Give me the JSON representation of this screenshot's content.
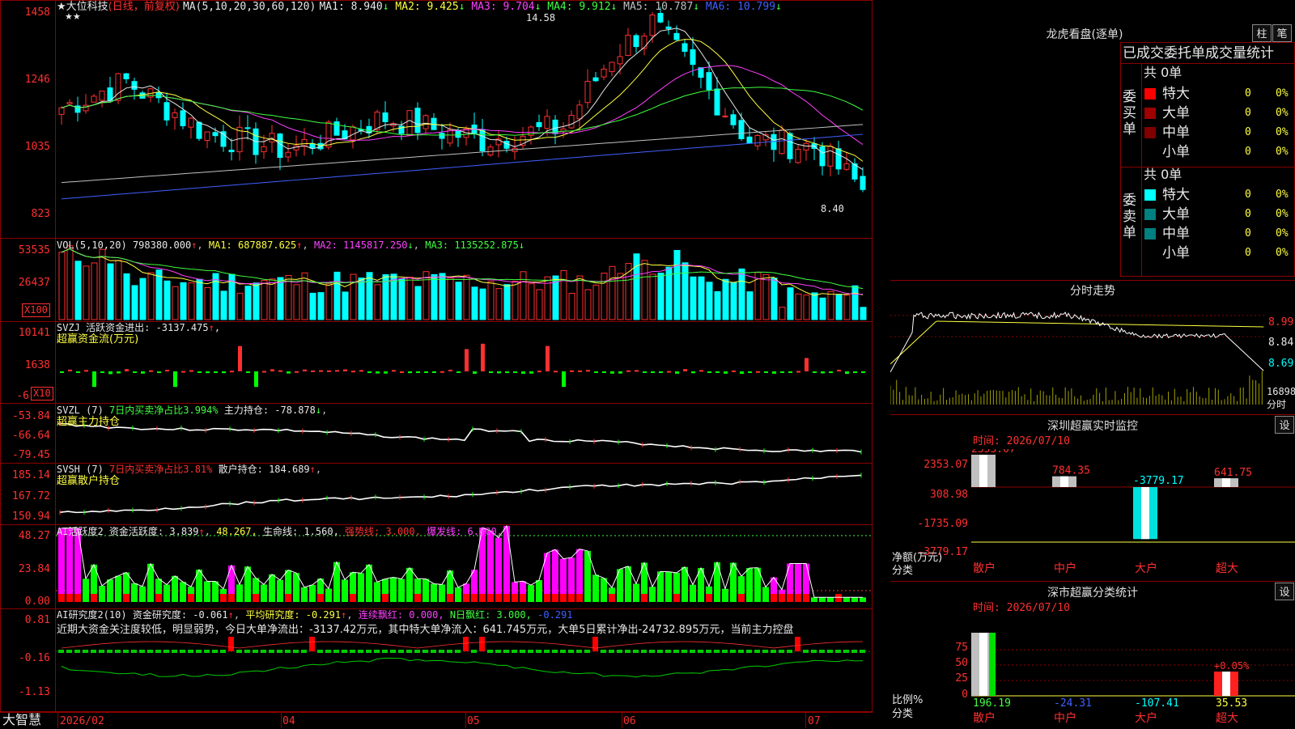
{
  "main": {
    "stock": "大位科技",
    "period": "(日线，前复权)",
    "ma_title": "MA(5,10,20,30,60,120)",
    "ma_vals": [
      {
        "label": "MA1:",
        "value": "8.940",
        "color": "#e8e8e8",
        "arrow": "↓"
      },
      {
        "label": "MA2:",
        "value": "9.425",
        "color": "#ffff40",
        "arrow": "↓"
      },
      {
        "label": "MA3:",
        "value": "9.704",
        "color": "#ff40ff",
        "arrow": "↓"
      },
      {
        "label": "MA4:",
        "value": "9.912",
        "color": "#40ff40",
        "arrow": "↓"
      },
      {
        "label": "MA5:",
        "value": "10.787",
        "color": "#c0c0c0",
        "arrow": "↓"
      },
      {
        "label": "MA6:",
        "value": "10.799",
        "color": "#4060ff",
        "arrow": "↓"
      }
    ],
    "yticks": [
      "1458",
      "1246",
      "1035",
      "823"
    ],
    "high_label": "14.58",
    "low_label": "8.40"
  },
  "vol": {
    "title": "VOL(5,10,20)",
    "value": "798380.000",
    "ma1": "MA1: 687887.625",
    "ma2": "MA2: 1145817.250",
    "ma3": "MA3: 1135252.875",
    "yticks": [
      "53535",
      "26437"
    ],
    "unit": "X100"
  },
  "svzj": {
    "title": "SVZJ  活跃资金进出: -3137.475",
    "subtitle": "超赢资金流(万元)",
    "yticks": [
      "10141",
      "1638",
      "-6"
    ],
    "unit": "X10"
  },
  "svzl": {
    "title": "SVZL (7)",
    "ratio": "7日内买卖净占比3.994%",
    "hold": "主力持仓: -78.878",
    "subtitle": "超赢主力持仓",
    "yticks": [
      "-53.84",
      "-66.64",
      "-79.45"
    ]
  },
  "svsh": {
    "title": "SVSH (7)",
    "ratio": "7日内买卖净占比3.81%",
    "hold": "散户持仓: 184.689",
    "subtitle": "超赢散户持仓",
    "yticks": [
      "185.14",
      "167.72",
      "150.94"
    ]
  },
  "ai1": {
    "title": "AI活跃度2",
    "v1": "资金活跃度: 3.839",
    "v2": "48.267,",
    "v3": "生命线: 1.560,",
    "v4": "强势线: 3.000,",
    "v5": "爆发线: 6.000,",
    "yticks": [
      "48.27",
      "23.84",
      "0.00"
    ]
  },
  "ai2": {
    "title": "AI研究度2(10)",
    "v1": "资金研究度: -0.061",
    "v2": "平均研究度: -0.291",
    "v3": "连续飘红: 0.000,",
    "v4": "N日飘红: 3.000,",
    "v5": "-0.291",
    "comment": "近期大资金关注度较低，明显弱势，今日大单净流出：-3137.42万元，其中特大单净流入：641.745万元，大单5日累计净出-24732.895万元，当前主力控盘",
    "yticks": [
      "0.81",
      "-0.16",
      "-1.13"
    ]
  },
  "xaxis": {
    "brand": "大智慧",
    "labels": [
      "2026/02",
      "04",
      "05",
      "06",
      "07"
    ]
  },
  "dragon": {
    "title": "龙虎看盘(逐单)",
    "btn1": "柱",
    "btn2": "笔",
    "header": "已成交委托单成交量统计",
    "buy_label": "委买单",
    "sell_label": "委卖单",
    "buy_total": "共 0单",
    "sell_total": "共 0单",
    "buy_rows": [
      {
        "name": "特大",
        "color": "#ff0000",
        "count": "0",
        "pct": "0%"
      },
      {
        "name": "大单",
        "color": "#a00000",
        "count": "0",
        "pct": "0%"
      },
      {
        "name": "中单",
        "color": "#800000",
        "count": "0",
        "pct": "0%"
      },
      {
        "name": "小单",
        "color": "#000000",
        "count": "0",
        "pct": "0%"
      }
    ],
    "sell_rows": [
      {
        "name": "特大",
        "color": "#00ffff",
        "count": "0",
        "pct": "0%"
      },
      {
        "name": "大单",
        "color": "#008080",
        "count": "0",
        "pct": "0%"
      },
      {
        "name": "中单",
        "color": "#008080",
        "count": "0",
        "pct": "0%"
      },
      {
        "name": "小单",
        "color": "#000000",
        "count": "0",
        "pct": "0%"
      }
    ]
  },
  "intraday": {
    "title": "分时走势",
    "yticks": [
      "8.99",
      "8.84",
      "8.69"
    ],
    "vol_label": "16898",
    "unit": "分时"
  },
  "monitor": {
    "title": "深圳超赢实时监控",
    "btn": "设",
    "time": "时间: 2026/07/10",
    "yticks": [
      "2353.07",
      "308.98",
      "-1735.09",
      "-3779.17"
    ],
    "unit1": "净额(万元)",
    "unit2": "分类",
    "cats": [
      "散户",
      "中户",
      "大户",
      "超大"
    ],
    "bar_labels": [
      "2353.07",
      "784.35",
      "-3779.17",
      "641.75"
    ]
  },
  "classify": {
    "title": "深市超赢分类统计",
    "btn": "设",
    "time": "时间: 2026/07/10",
    "yticks": [
      "75",
      "50",
      "25",
      "0"
    ],
    "unit1": "比例%",
    "unit2": "分类",
    "cats": [
      "散户",
      "中户",
      "大户",
      "超大"
    ],
    "values": [
      "196.19",
      "-24.31",
      "-107.41",
      "35.53"
    ],
    "extra": "+0.05%"
  }
}
